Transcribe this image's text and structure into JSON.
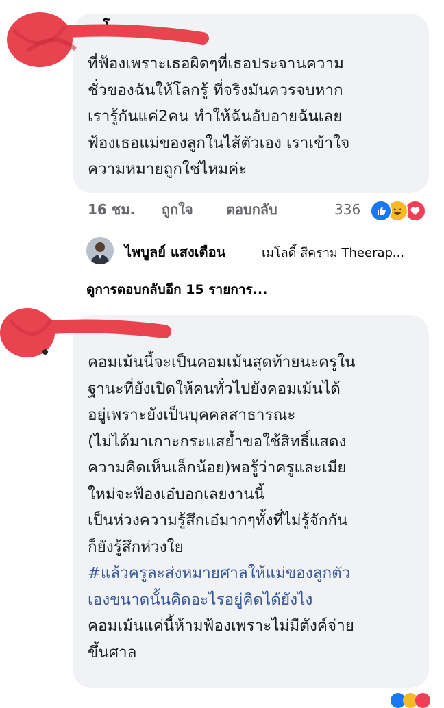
{
  "comments": [
    {
      "author_visible": "โ ...",
      "lines": [
        "ที่ฟ้องเพราะเธอผิดๆที่เธอประจานความ",
        "ชั่วของฉันให้โลกรู้ ที่จริงมันควรจบหาก",
        "เรารู้กันแค่2คน ทำให้ฉันอับอายฉันเลย",
        "ฟ้องเธอแม่ของลูกในไส้ตัวเอง  เราเข้าใจ",
        "ความหมายถูกใช่ไหมค่ะ"
      ],
      "time": "16 ชม.",
      "like_label": "ถูกใจ",
      "reply_label": "ตอบกลับ",
      "reaction_count": "336",
      "reaction_icons": [
        "like-icon",
        "haha-icon",
        "love-icon"
      ]
    },
    {
      "lines": [
        "คอมเม้นนี้จะเป็นคอมเม้นสุดท้ายนะครูใน",
        "ฐานะที่ยังเปิดให้คนทั่วไปยังคอมเม้นได้",
        "อยู่เพราะยังเป็นบุคคลสาธารณะ",
        "(ไม่ได้มาเกาะกระแสย้ำขอใช้สิทธิ์แสดง",
        "ความคิดเห็นเล็กน้อย)พอรู้ว่าครูและเมีย",
        "ใหม่จะฟ้องเอ๋บอกเลยงานนี้",
        "เป็นห่วงความรู้สึกเอ๋มากๆทั้งที่ไม่รู้จักกัน",
        "ก็ยังรู้สึกห่วงใย"
      ],
      "hashtag_lines": [
        "#แล้วครูละส่งหมายศาลให้แม่ของลูกตัว",
        "เองขนาดนั้นคิดอะไรอยู่คิดได้ยังไง"
      ],
      "tail_lines": [
        "คอมเม้นแค่นี้ห้ามฟ้องเพราะไม่มีตังค์จ่าย",
        "ขึ้นศาล"
      ]
    }
  ],
  "reply": {
    "name": "ไพบูลย์ แสงเดือน",
    "preview": "เมโลดี้ สีคราม Theerap..."
  },
  "more_replies": "ดูการตอบกลับอีก 15 รายการ...",
  "colors": {
    "bubble": "#f0f2f5",
    "meta": "#65676b",
    "link": "#385898",
    "scribble": "#e8434f",
    "like": "#1877f2",
    "haha": "#f7b928",
    "love": "#f33e58"
  }
}
